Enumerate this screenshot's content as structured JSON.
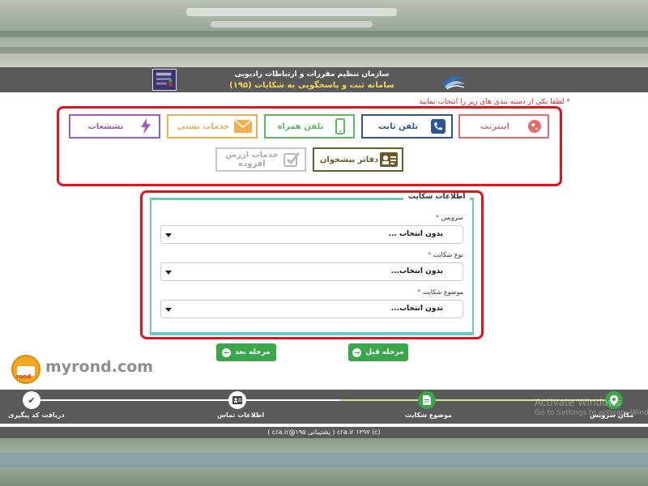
{
  "header": {
    "org_name": "سازمان تنظیم مقررات و ارتباطات رادیویی",
    "system_name": "سامانه ثبت و پاسخگویی به شکایات (۱۹۵)"
  },
  "hint": {
    "asterisk": "*",
    "text": "لطفا یکی از دسته بندی های زیر را انتخاب نمایید"
  },
  "categories": [
    {
      "label": "اینترنت",
      "color": "#e46a6a",
      "icon": "globe-icon"
    },
    {
      "label": "تلفن ثابت",
      "color": "#2f5597",
      "icon": "phone-icon"
    },
    {
      "label": "تلفن همراه",
      "color": "#5cb85c",
      "icon": "mobile-icon"
    },
    {
      "label": "خدمات پستی",
      "color": "#f0ad4e",
      "icon": "envelope-icon"
    },
    {
      "label": "تششعات",
      "color": "#a25ac4",
      "icon": "lightning-icon"
    },
    {
      "label": "دفاتر پیشخوان",
      "color": "#6b5a2a",
      "icon": "id-card-icon"
    },
    {
      "label": "خدمات ارزش افزوده",
      "color": "#c8c8c8",
      "icon": "checkbox-icon"
    }
  ],
  "form": {
    "legend": "اطلاعات شکایت",
    "service_label": "سرویس",
    "service_value": "بدون انتخاب ...",
    "type_label": "نوع شکایت",
    "type_value": "بدون انتخاب...",
    "subject_label": "موضوع شکایت",
    "subject_value": "بدون انتخاب...",
    "required_mark": "*"
  },
  "buttons": {
    "next": "مرحله بعد",
    "prev": "مرحله قبل"
  },
  "watermark": {
    "site": "myrond.com",
    "logo_text": "rond"
  },
  "steps": [
    {
      "label": "مکان سرویس",
      "state": "active"
    },
    {
      "label": "موضوع شکایت",
      "state": "current"
    },
    {
      "label": "اطلاعات تماس",
      "state": "pending"
    },
    {
      "label": "دریافت کد پیگیری",
      "state": "pending"
    }
  ],
  "os_overlay": {
    "line1": "Activate Windows",
    "line2": "Go to Settings to activate Windows."
  },
  "footer": {
    "text": "(c) cra.ir ۱۳۹۷ ( پشتیبانی ۱۹۵@cra.ir )"
  },
  "colors": {
    "accent_red": "#e0141e",
    "header_gray": "#5a5a5a",
    "button_green": "#3aa84a",
    "fieldset_teal": "#6cc8cf"
  }
}
